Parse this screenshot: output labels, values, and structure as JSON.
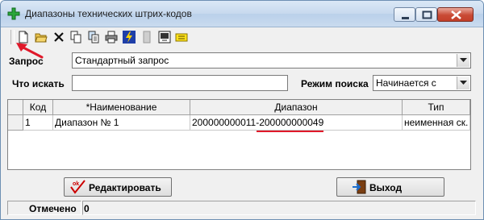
{
  "window": {
    "title": "Диапазоны технических штрих-кодов"
  },
  "toolbar": {
    "buttons": [
      "new-document-icon",
      "open-folder-icon",
      "delete-icon",
      "copy-icon",
      "copy-special-icon",
      "print-icon",
      "lightning-icon",
      "disabled-icon",
      "export-icon",
      "note-icon"
    ]
  },
  "form": {
    "query_label": "Запрос",
    "query_value": "Стандартный запрос",
    "search_label": "Что искать",
    "search_value": "",
    "search_mode_label": "Режим поиска",
    "search_mode_value": "Начинается с"
  },
  "table": {
    "columns": [
      "Код",
      "*Наименование",
      "Диапазон",
      "Тип"
    ],
    "rows": [
      [
        "1",
        "Диапазон № 1",
        "200000000011-200000000049",
        "неименная ск."
      ]
    ]
  },
  "buttons": {
    "edit": "Редактировать",
    "exit": "Выход"
  },
  "status": {
    "label": "Отмечено",
    "value": "0"
  },
  "colors": {
    "annotation": "#e0192a",
    "titlebar": "#c7d9ee"
  }
}
